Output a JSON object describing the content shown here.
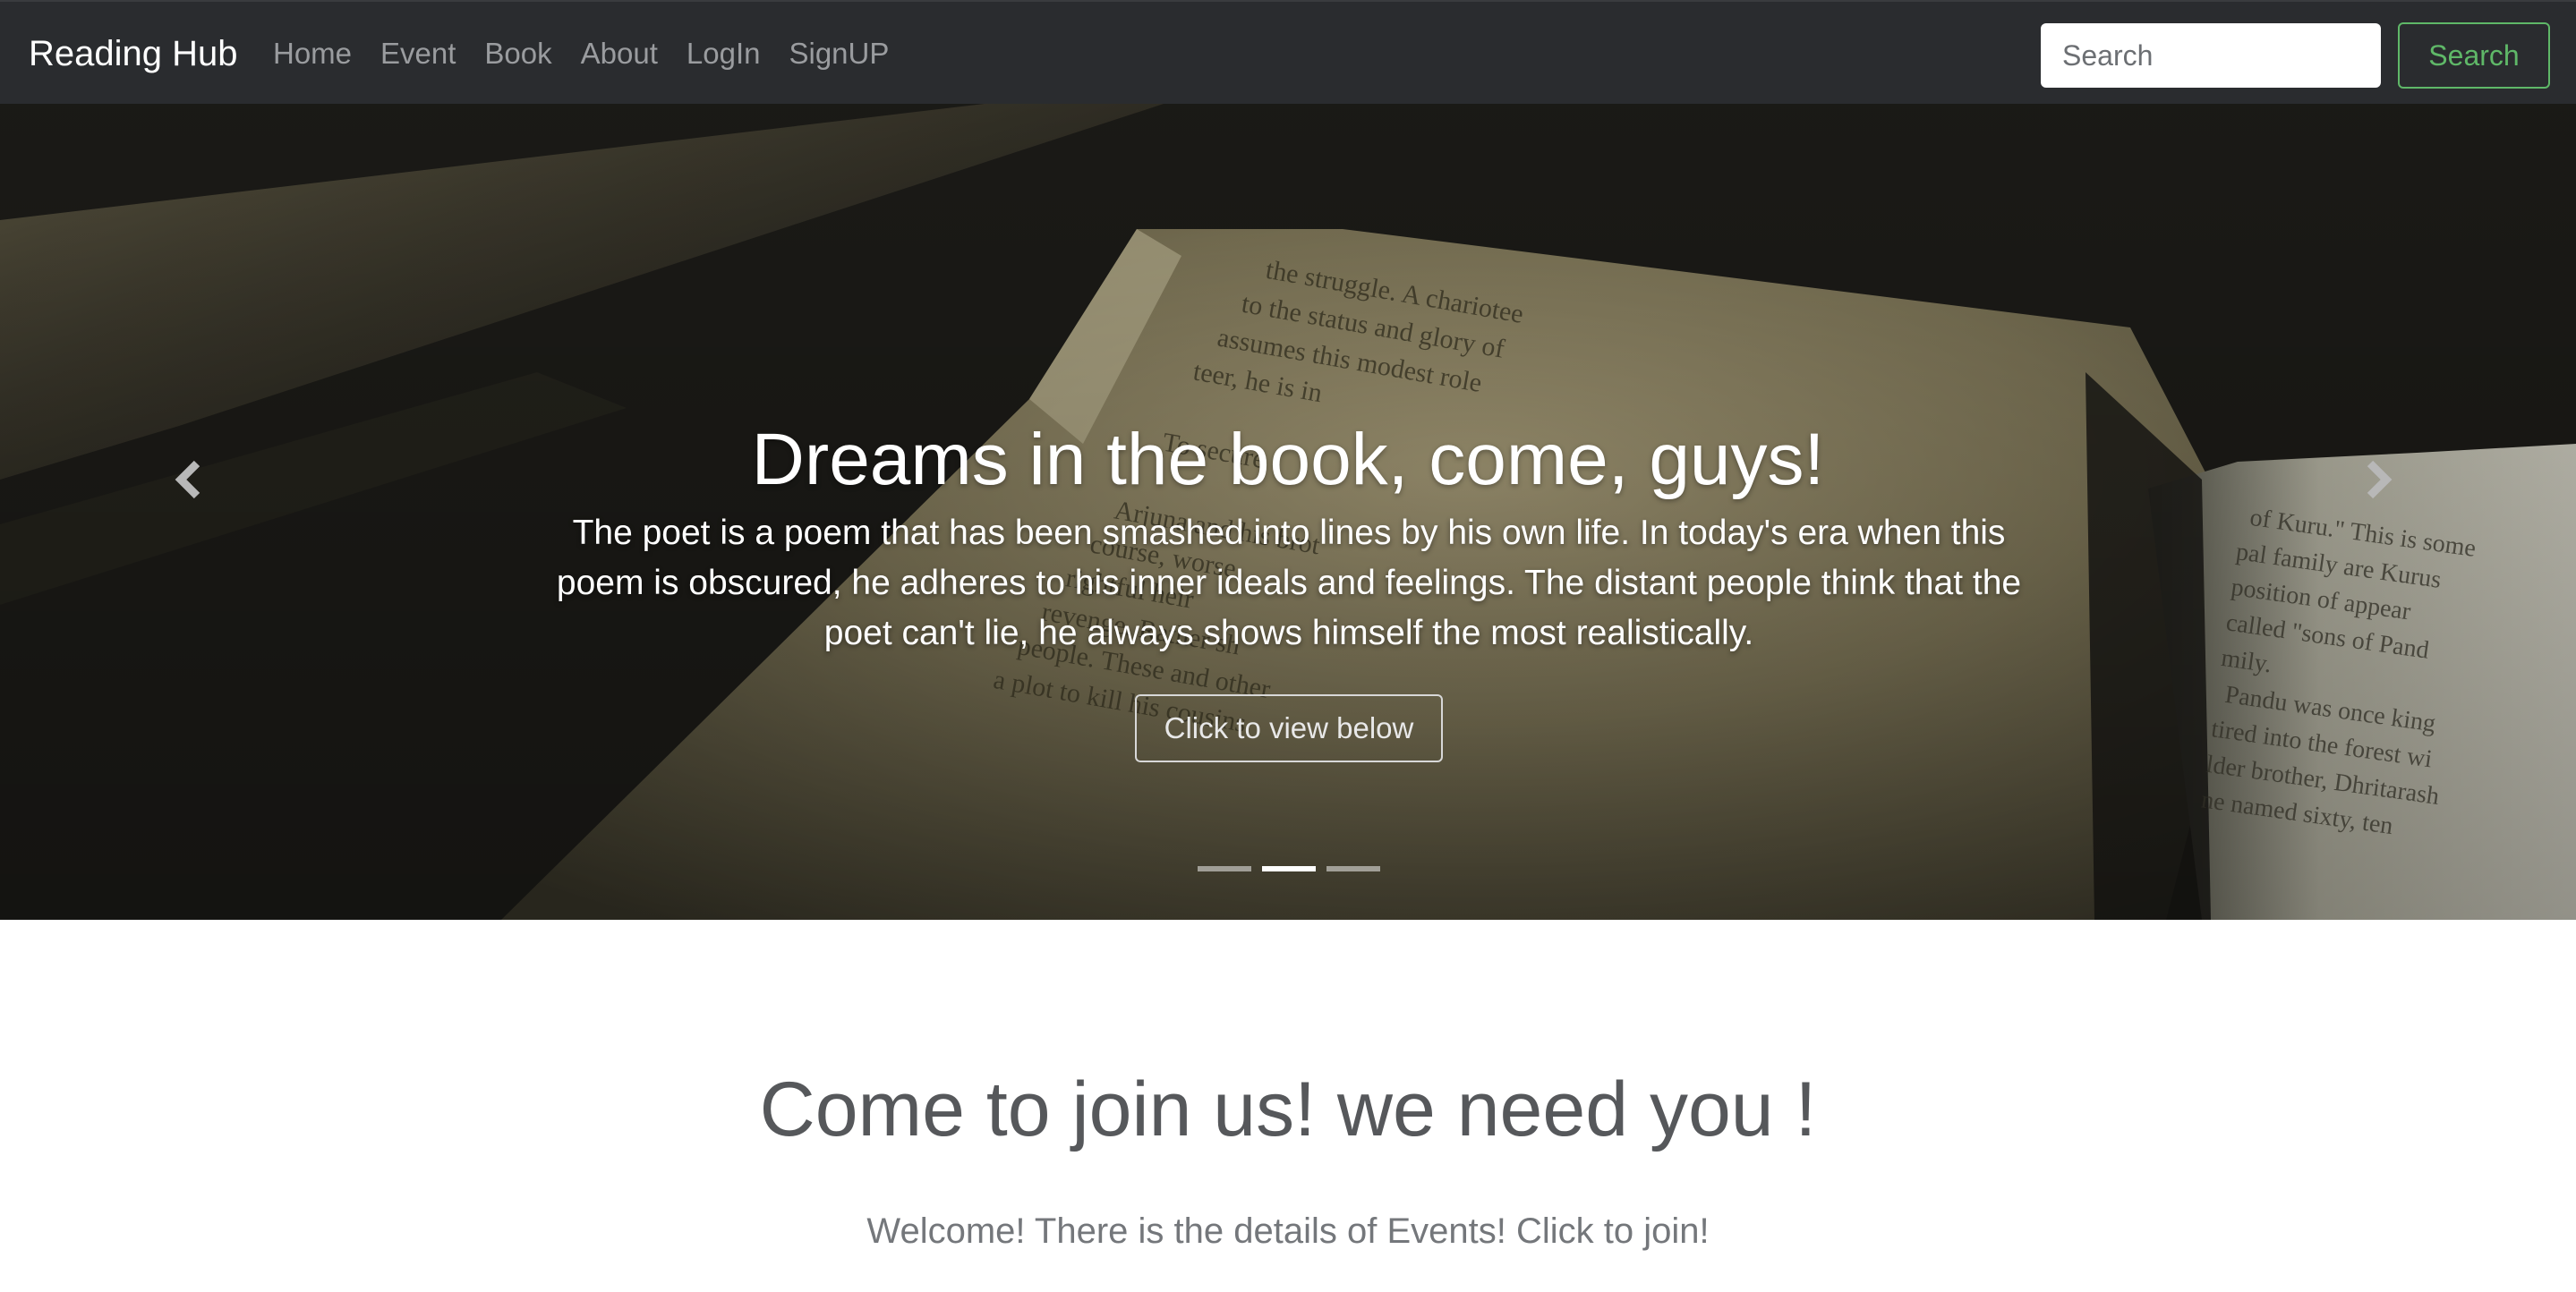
{
  "navbar": {
    "brand": "Reading Hub",
    "links": [
      "Home",
      "Event",
      "Book",
      "About",
      "LogIn",
      "SignUP"
    ],
    "search_placeholder": "Search",
    "search_button": "Search"
  },
  "carousel": {
    "title": "Dreams in the book, come, guys!",
    "text": "The poet is a poem that has been smashed into lines by his own life. In today's era when this poem is obscured, he adheres to his inner ideals and feelings. The distant people think that the poet can't lie, he always shows himself the most realistically.",
    "button": "Click to view below",
    "indicator_count": 3,
    "active_indicator": 2,
    "book_text_left": [
      "the struggle. A chariotee",
      "to the status and glory of",
      "assumes this modest role",
      "teer, he is in",
      "To secure",
      "Arjuna and his brot",
      "course, worse",
      "rightful heir",
      "revenge. Rather sh",
      "people. These and other",
      "a plot to kill his cousins"
    ],
    "book_text_right": [
      "of Kuru.\" This is some",
      "pal family are Kurus",
      "position of appear",
      "called \"sons of Pand",
      "mily.",
      "Pandu was once king",
      "tired into the forest wi",
      "lder brother, Dhritarash",
      "ne named sixty, ten"
    ]
  },
  "join": {
    "heading": "Come to join us! we need you !",
    "subtext": "Welcome! There is the details of Events! Click to join!"
  },
  "colors": {
    "navbar_bg": "#2a2c2f",
    "accent_green": "#5fb868",
    "heading_gray": "#56585b"
  }
}
